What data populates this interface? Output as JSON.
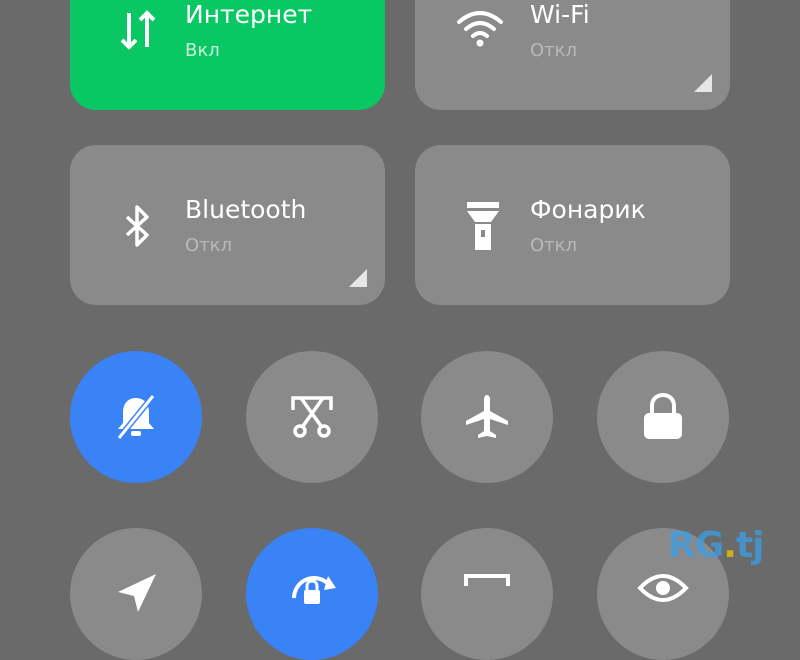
{
  "tiles": [
    {
      "title": "Интернет",
      "status": "Вкл",
      "icon": "mobile-data-icon",
      "active": true,
      "color": "#09c763"
    },
    {
      "title": "Wi-Fi",
      "status": "Откл",
      "icon": "wifi-icon",
      "active": false
    },
    {
      "title": "Bluetooth",
      "status": "Откл",
      "icon": "bluetooth-icon",
      "active": false
    },
    {
      "title": "Фонарик",
      "status": "Откл",
      "icon": "flashlight-icon",
      "active": false
    }
  ],
  "round_buttons": [
    {
      "icon": "silent-mode-icon",
      "active": true
    },
    {
      "icon": "screenshot-icon",
      "active": false
    },
    {
      "icon": "airplane-icon",
      "active": false
    },
    {
      "icon": "lock-icon",
      "active": false
    },
    {
      "icon": "location-icon",
      "active": false
    },
    {
      "icon": "auto-rotate-lock-icon",
      "active": true
    },
    {
      "icon": "screen-recorder-icon",
      "active": false
    },
    {
      "icon": "reading-mode-icon",
      "active": false
    }
  ],
  "colors": {
    "background": "#6a6a6a",
    "tile": "#8a8a8a",
    "active_green": "#09c763",
    "active_blue": "#3a83f7"
  },
  "watermark": {
    "part1": "RG",
    "part2": ".",
    "part3": "tj"
  }
}
